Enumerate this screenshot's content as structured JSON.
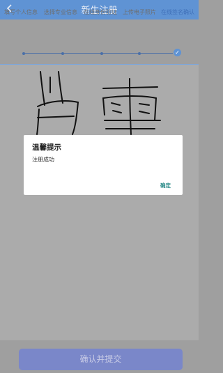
{
  "header": {
    "title": "新生注册",
    "back_icon": "chevron-left-icon"
  },
  "steps": [
    {
      "label": "填写个人信息",
      "active": false
    },
    {
      "label": "选择专业信息",
      "active": false
    },
    {
      "label": "在线身份验证",
      "active": false
    },
    {
      "label": "上传电子照片",
      "active": false
    },
    {
      "label": "在线签名确认",
      "active": true
    }
  ],
  "footer": {
    "submit_label": "确认并提交"
  },
  "dialog": {
    "title": "温馨提示",
    "message": "注册成功",
    "ok_label": "确定"
  },
  "colors": {
    "header": "#5f93d4",
    "accent": "#3f6fb8",
    "submit": "#7a87c9",
    "ok": "#2a8a88"
  }
}
